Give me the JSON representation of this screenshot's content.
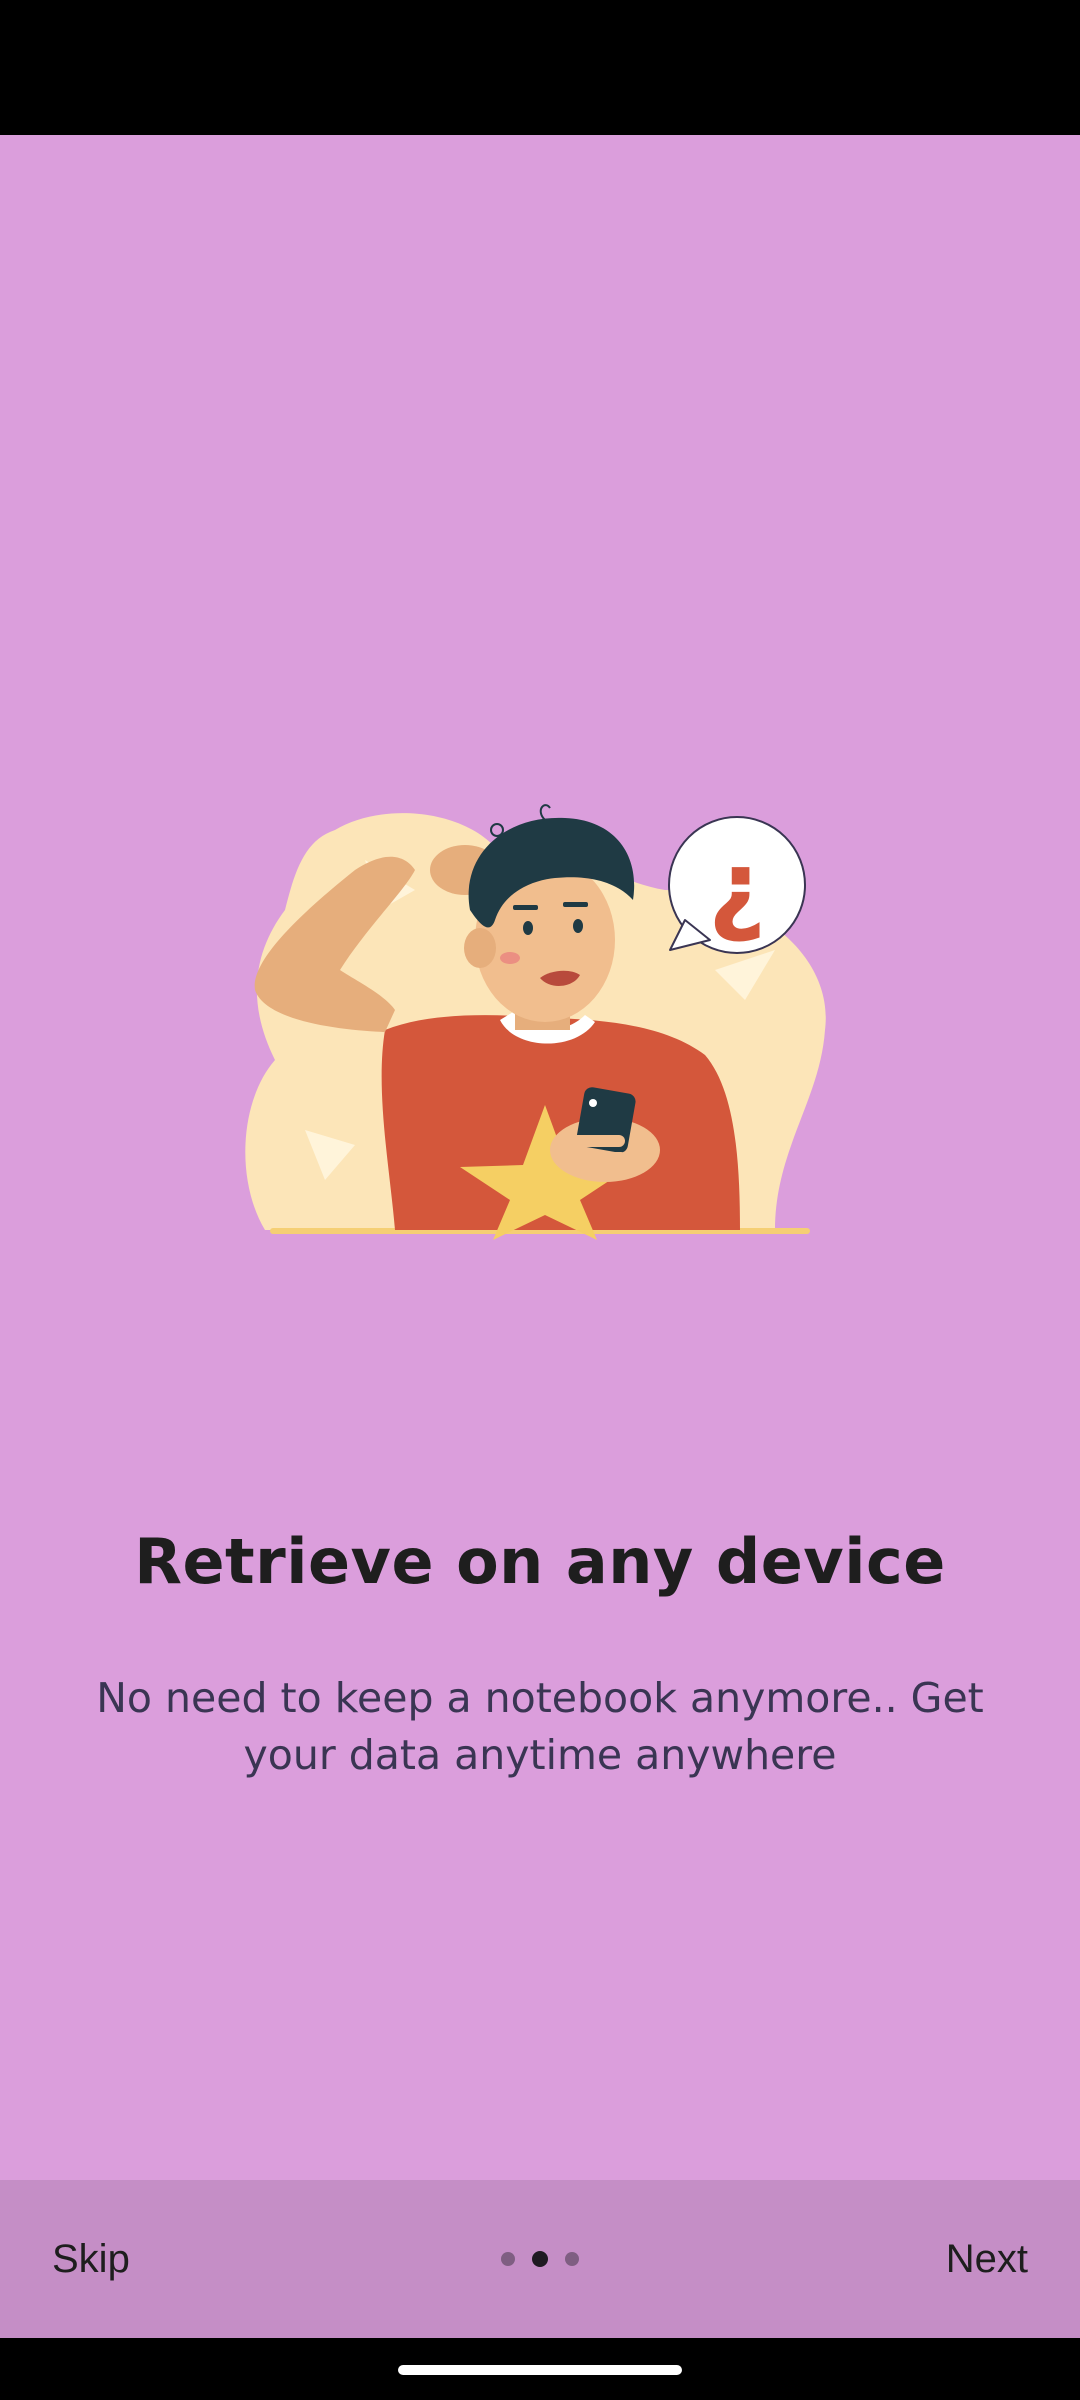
{
  "onboarding": {
    "title": "Retrieve on any device",
    "description": "No need to keep a notebook anymore.. Get your data anytime anywhere",
    "illustration_icon": "confused-man-with-phone-illustration",
    "speech_bubble_glyph": "¿"
  },
  "navigation": {
    "skip_label": "Skip",
    "next_label": "Next",
    "page_count": 3,
    "current_page": 2
  },
  "colors": {
    "background": "#DB9EDC",
    "bottom_bar": "#C58EC6",
    "title": "#1E1E1E",
    "description": "#3A3553",
    "active_dot": "#1F1A22",
    "inactive_dot": "#7F5E82"
  }
}
